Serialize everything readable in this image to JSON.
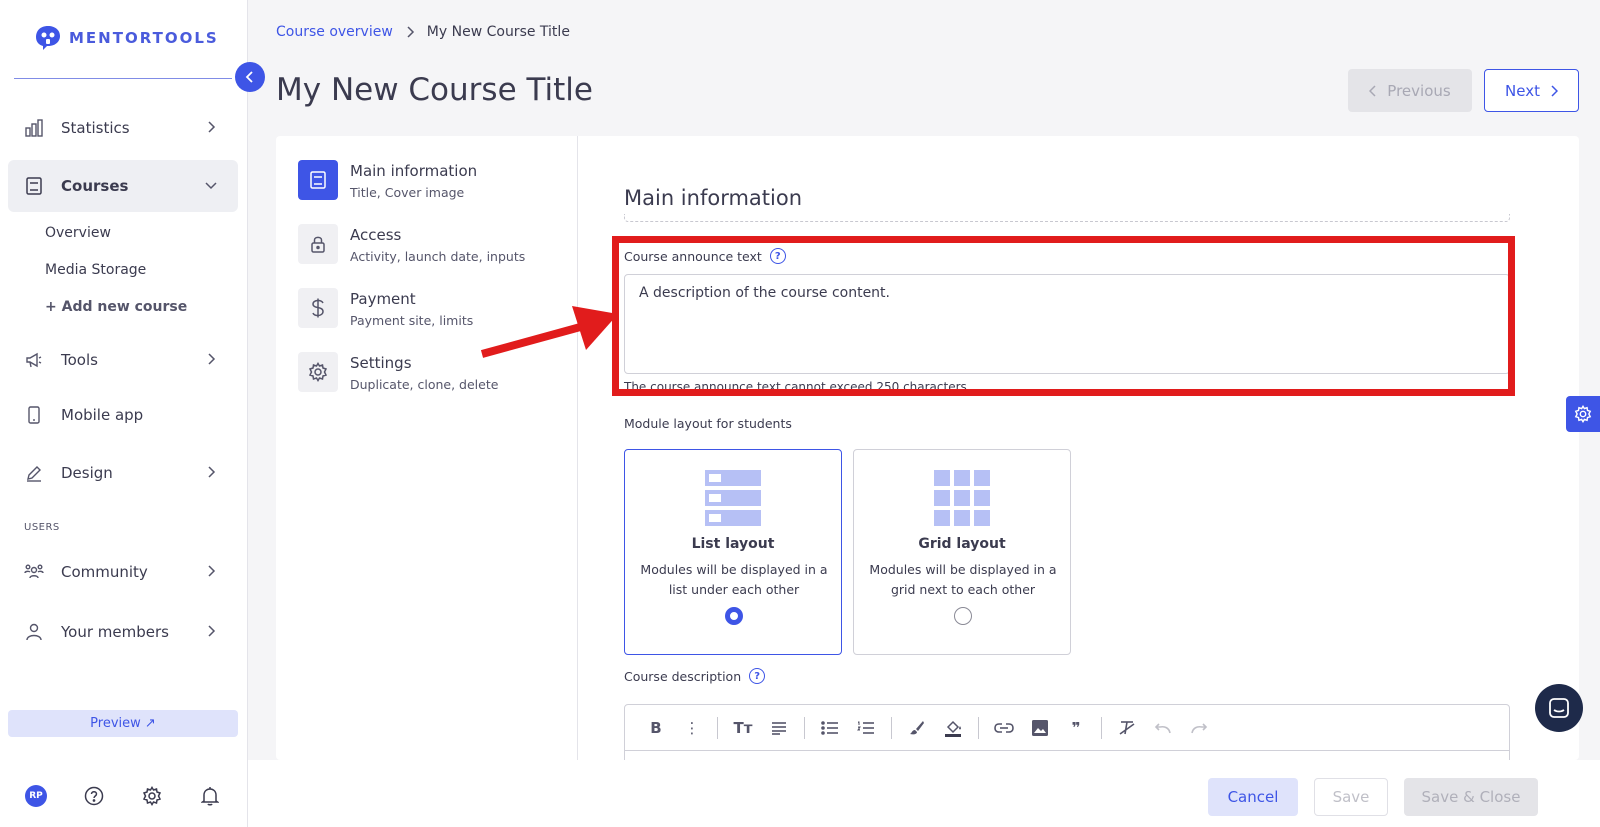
{
  "app": {
    "logo_text": "MENTORTOOLS"
  },
  "sidebar": {
    "items": [
      {
        "label": "Statistics",
        "icon": "bar-chart-icon"
      },
      {
        "label": "Courses",
        "icon": "book-icon"
      },
      {
        "label": "Tools",
        "icon": "megaphone-icon"
      },
      {
        "label": "Mobile app",
        "icon": "phone-icon"
      },
      {
        "label": "Design",
        "icon": "pencil-icon"
      },
      {
        "label": "Community",
        "icon": "people-icon"
      },
      {
        "label": "Your members",
        "icon": "user-icon"
      }
    ],
    "courses_sub": [
      "Overview",
      "Media Storage",
      "+ Add new course"
    ],
    "section_users": "USERS",
    "preview_label": "Preview ↗",
    "avatar_initials": "RP"
  },
  "header": {
    "breadcrumb_link": "Course overview",
    "breadcrumb_current": "My New Course Title",
    "title": "My New Course Title",
    "prev_label": "Previous",
    "next_label": "Next"
  },
  "steps": [
    {
      "title": "Main information",
      "sub": "Title, Cover image",
      "icon": "book-icon"
    },
    {
      "title": "Access",
      "sub": "Activity, launch date, inputs",
      "icon": "lock-icon"
    },
    {
      "title": "Payment",
      "sub": "Payment site, limits",
      "icon": "dollar-icon"
    },
    {
      "title": "Settings",
      "sub": "Duplicate, clone, delete",
      "icon": "gear-icon"
    }
  ],
  "form": {
    "section_title": "Main information",
    "announce_label": "Course announce text",
    "announce_value": "A description of the course content.",
    "announce_hint": "The course announce text cannot exceed 250 characters.",
    "module_layout_label": "Module layout for students",
    "layouts": [
      {
        "title": "List layout",
        "desc": "Modules will be displayed in a list under each other",
        "selected": true
      },
      {
        "title": "Grid layout",
        "desc": "Modules will be displayed in a grid next to each other",
        "selected": false
      }
    ],
    "description_label": "Course description",
    "toolbar_bold": "B",
    "toolbar_more": "⋮",
    "toolbar_textsize": "Tт",
    "toolbar_quote": "❞"
  },
  "footer": {
    "cancel": "Cancel",
    "save": "Save",
    "save_close": "Save & Close"
  },
  "colors": {
    "accent": "#3e55e6",
    "annotation": "#e11c1c"
  }
}
